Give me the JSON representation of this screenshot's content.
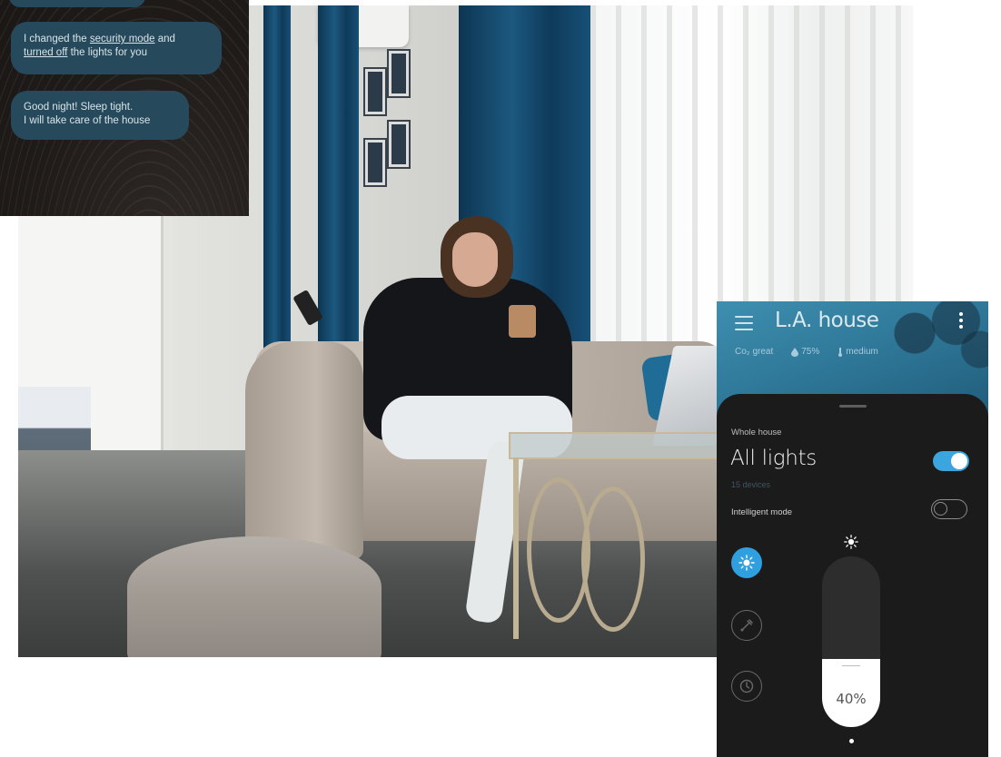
{
  "chat": {
    "messages": [
      {
        "parts": [
          {
            "text": ""
          }
        ]
      },
      {
        "parts": [
          {
            "text": "I changed the "
          },
          {
            "text": "security mode",
            "link": true
          },
          {
            "text": " and "
          },
          {
            "text": "turned off",
            "link": true
          },
          {
            "text": " the lights for you"
          }
        ]
      },
      {
        "lines": [
          "Good night! Sleep tight.",
          "I will take care of the house"
        ]
      }
    ]
  },
  "phone": {
    "header": {
      "title": "L.A. house",
      "status": [
        {
          "icon": "co2-icon",
          "text": "Co₂ great"
        },
        {
          "icon": "humidity-icon",
          "text": "75%"
        },
        {
          "icon": "temperature-icon",
          "text": "medium"
        }
      ]
    },
    "group": {
      "scope": "Whole house",
      "title": "All lights",
      "device_count": "15 devices",
      "power_on": true,
      "intelligent_mode_label": "Intelligent mode",
      "intelligent_mode_on": false
    },
    "side_buttons": [
      {
        "icon": "brightness-icon",
        "active": true
      },
      {
        "icon": "color-palette-icon",
        "active": false
      },
      {
        "icon": "timer-icon",
        "active": false
      }
    ],
    "brightness": {
      "level": 0.4,
      "label": "40%"
    },
    "colors": {
      "accent": "#3aa6dd",
      "sheet": "#1c1b1b",
      "header": "#2f7899"
    }
  }
}
